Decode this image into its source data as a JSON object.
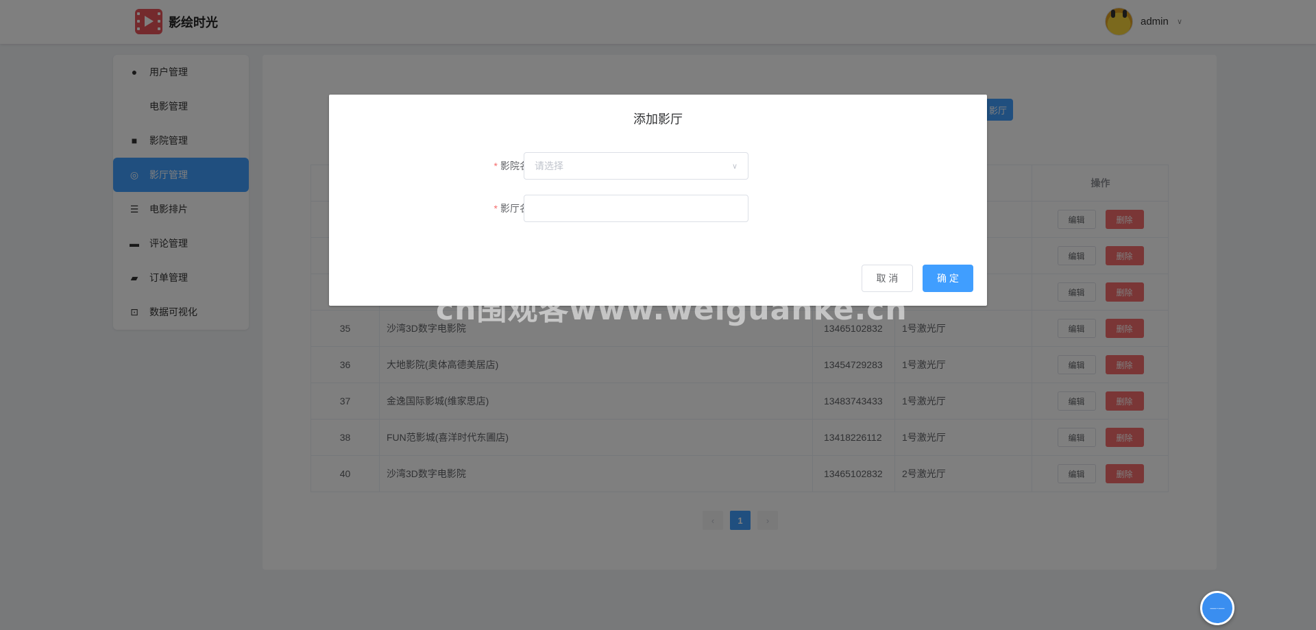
{
  "header": {
    "brand": "影绘时光",
    "username": "admin",
    "logo_icon": "film-logo-icon",
    "caret_icon": "chevron-down-icon"
  },
  "sidebar": {
    "items": [
      {
        "label": "用户管理",
        "icon": "user-icon",
        "active": false
      },
      {
        "label": "电影管理",
        "icon": "",
        "active": false
      },
      {
        "label": "影院管理",
        "icon": "camera-icon",
        "active": false
      },
      {
        "label": "影厅管理",
        "icon": "hall-icon",
        "active": true
      },
      {
        "label": "电影排片",
        "icon": "list-icon",
        "active": false
      },
      {
        "label": "评论管理",
        "icon": "comment-icon",
        "active": false
      },
      {
        "label": "订单管理",
        "icon": "ticket-icon",
        "active": false
      },
      {
        "label": "数据可视化",
        "icon": "chart-icon",
        "active": false
      }
    ]
  },
  "main": {
    "add_button_label": "影厅",
    "table": {
      "op_header": "操作",
      "edit_label": "编辑",
      "delete_label": "删除",
      "rows": [
        {
          "id": "35",
          "cinema": "沙湾3D数字电影院",
          "phone": "13465102832",
          "hall": "1号激光厅"
        },
        {
          "id": "36",
          "cinema": "大地影院(奥体高德美居店)",
          "phone": "13454729283",
          "hall": "1号激光厅"
        },
        {
          "id": "37",
          "cinema": "金逸国际影城(维家思店)",
          "phone": "13483743433",
          "hall": "1号激光厅"
        },
        {
          "id": "38",
          "cinema": "FUN范影城(喜洋时代东圃店)",
          "phone": "13418226112",
          "hall": "1号激光厅"
        },
        {
          "id": "40",
          "cinema": "沙湾3D数字电影院",
          "phone": "13465102832",
          "hall": "2号激光厅"
        }
      ]
    },
    "pagination": {
      "current": "1",
      "prev": "‹",
      "next": "›"
    }
  },
  "dialog": {
    "title": "添加影厅",
    "cinema_label": "影院名",
    "cinema_placeholder": "请选择",
    "hall_label": "影厅名",
    "hall_value": "",
    "required_mark": "*",
    "cancel_label": "取 消",
    "confirm_label": "确 定"
  },
  "watermark": "cn围观客www.weiguanke.cn",
  "colors": {
    "primary": "#409eff",
    "danger": "#f56c6c",
    "overlay": "rgba(0,0,0,0.5)"
  }
}
